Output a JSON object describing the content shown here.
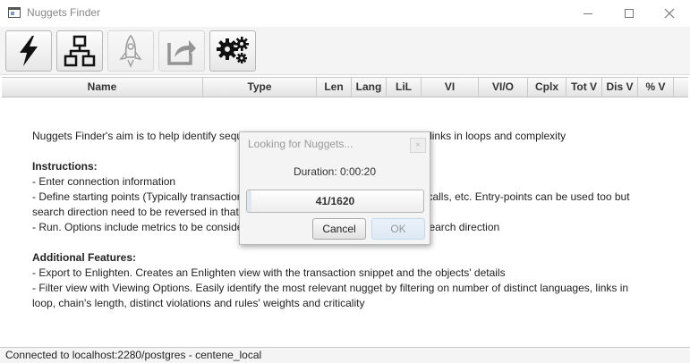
{
  "window": {
    "title": "Nuggets Finder"
  },
  "toolbar": {
    "buttons": [
      {
        "icon": "lightning-icon",
        "enabled": true
      },
      {
        "icon": "hierarchy-icon",
        "enabled": true
      },
      {
        "icon": "rocket-icon",
        "enabled": false
      },
      {
        "icon": "export-icon",
        "enabled": false
      },
      {
        "icon": "gears-icon",
        "enabled": true
      }
    ]
  },
  "table": {
    "columns": [
      "Name",
      "Type",
      "Len",
      "Lang",
      "LiL",
      "VI",
      "VI/O",
      "Cplx",
      "Tot V",
      "Dis V",
      "% V"
    ]
  },
  "help": {
    "intro": "Nuggets Finder's aim is to help identify sequ",
    "intro_tail": "links in loops and complexity",
    "instructions_heading": "Instructions:",
    "line1": "- Enter connection information",
    "line2_a": "- Define starting points (Typically transaction",
    "line2_b": "calls, etc. Entry-points can be used too but",
    "line3": "search direction need to be reversed in that",
    "line4_a": "- Run. Options include metrics to be conside",
    "line4_b": "earch direction",
    "features_heading": "Additional Features:",
    "feature1": "- Export to Enlighten. Creates an Enlighten view with the transaction snippet and the objects' details",
    "feature2": "- Filter view with Viewing Options. Easily identify the most relevant nugget by filtering on number of distinct languages, links in",
    "feature3": "loop, chain's length, distinct violations and rules' weights and criticality"
  },
  "dialog": {
    "title": "Looking for Nuggets...",
    "close": "×",
    "duration": "Duration: 0:00:20",
    "progress_text": "41/1620",
    "progress_fraction": 0.0253,
    "cancel_label": "Cancel",
    "ok_label": "OK"
  },
  "status": {
    "text": "Connected to localhost:2280/postgres - centene_local"
  }
}
